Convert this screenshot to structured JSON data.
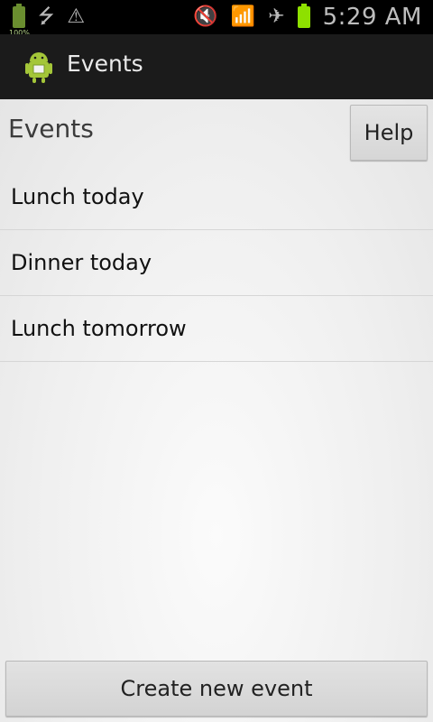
{
  "status_bar": {
    "battery_left_label": "100%",
    "time": "5:29 AM",
    "left_icons": [
      "battery-icon",
      "usb-icon",
      "warning-icon"
    ],
    "right_icons": [
      "mute-icon",
      "wifi-icon",
      "airplane-icon",
      "battery-icon"
    ]
  },
  "action_bar": {
    "title": "Events",
    "app_icon": "android-icon"
  },
  "main": {
    "heading": "Events",
    "help_label": "Help",
    "events": [
      {
        "label": "Lunch today"
      },
      {
        "label": "Dinner today"
      },
      {
        "label": "Lunch tomorrow"
      }
    ],
    "create_label": "Create new event"
  },
  "colors": {
    "status_bg": "#000000",
    "action_bg": "#1b1b1b",
    "content_bg": "#ececec",
    "battery_green": "#8ee000"
  }
}
